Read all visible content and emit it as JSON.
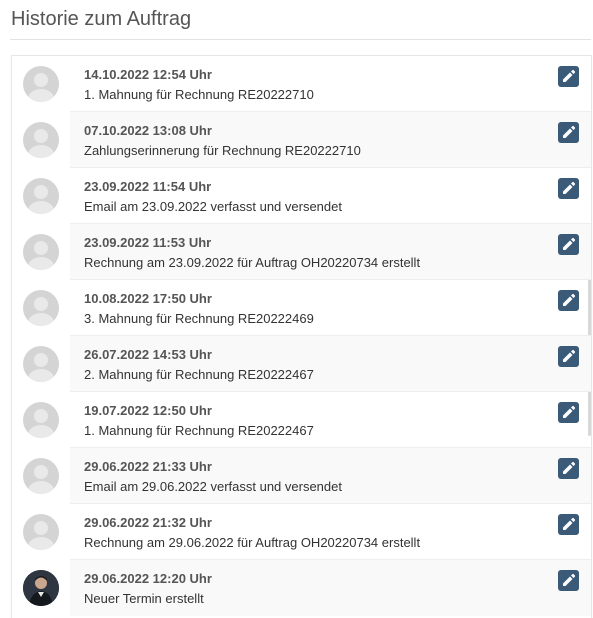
{
  "header": {
    "title": "Historie zum Auftrag"
  },
  "colors": {
    "edit_button": "#3a5a78",
    "avatar_placeholder": "#d4d4d4",
    "row_alt": "#f9f9f9"
  },
  "history": [
    {
      "date": "14.10.2022 12:54 Uhr",
      "text": "1. Mahnung für Rechnung RE20222710",
      "avatar": "placeholder-avatar",
      "edit_icon": "pencil-icon"
    },
    {
      "date": "07.10.2022 13:08 Uhr",
      "text": "Zahlungserinnerung für Rechnung RE20222710",
      "avatar": "placeholder-avatar",
      "edit_icon": "pencil-icon"
    },
    {
      "date": "23.09.2022 11:54 Uhr",
      "text": "Email am 23.09.2022 verfasst und versendet",
      "avatar": "placeholder-avatar",
      "edit_icon": "pencil-icon"
    },
    {
      "date": "23.09.2022 11:53 Uhr",
      "text": "Rechnung am 23.09.2022 für Auftrag OH20220734 erstellt",
      "avatar": "placeholder-avatar",
      "edit_icon": "pencil-icon"
    },
    {
      "date": "10.08.2022 17:50 Uhr",
      "text": "3. Mahnung für Rechnung RE20222469",
      "avatar": "placeholder-avatar",
      "edit_icon": "pencil-icon"
    },
    {
      "date": "26.07.2022 14:53 Uhr",
      "text": "2. Mahnung für Rechnung RE20222467",
      "avatar": "placeholder-avatar",
      "edit_icon": "pencil-icon"
    },
    {
      "date": "19.07.2022 12:50 Uhr",
      "text": "1. Mahnung für Rechnung RE20222467",
      "avatar": "placeholder-avatar",
      "edit_icon": "pencil-icon"
    },
    {
      "date": "29.06.2022 21:33 Uhr",
      "text": "Email am 29.06.2022 verfasst und versendet",
      "avatar": "placeholder-avatar",
      "edit_icon": "pencil-icon"
    },
    {
      "date": "29.06.2022 21:32 Uhr",
      "text": "Rechnung am 29.06.2022 für Auftrag OH20220734 erstellt",
      "avatar": "placeholder-avatar",
      "edit_icon": "pencil-icon"
    },
    {
      "date": "29.06.2022 12:20 Uhr",
      "text": "Neuer Termin erstellt",
      "avatar": "user-photo-avatar",
      "edit_icon": "pencil-icon"
    }
  ]
}
